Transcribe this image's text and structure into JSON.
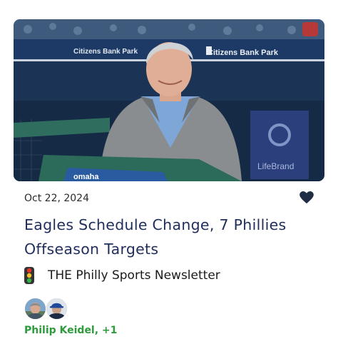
{
  "post": {
    "date": "Oct 22, 2024",
    "title": "Eagles Schedule Change, 7 Phillies Offseason Targets",
    "publication": "THE Philly Sports Newsletter",
    "authors": "Philip Keidel, +1",
    "author_color": "#2d9b3b",
    "title_color": "#1f2d5a"
  },
  "hero": {
    "banner_texts": [
      "Citizens Bank Park",
      "Citizens Bank Park"
    ],
    "sign_text": "LifeBrand",
    "rail_text": "omaha"
  },
  "icons": {
    "like": "heart-icon",
    "publication": "traffic-light-icon"
  }
}
